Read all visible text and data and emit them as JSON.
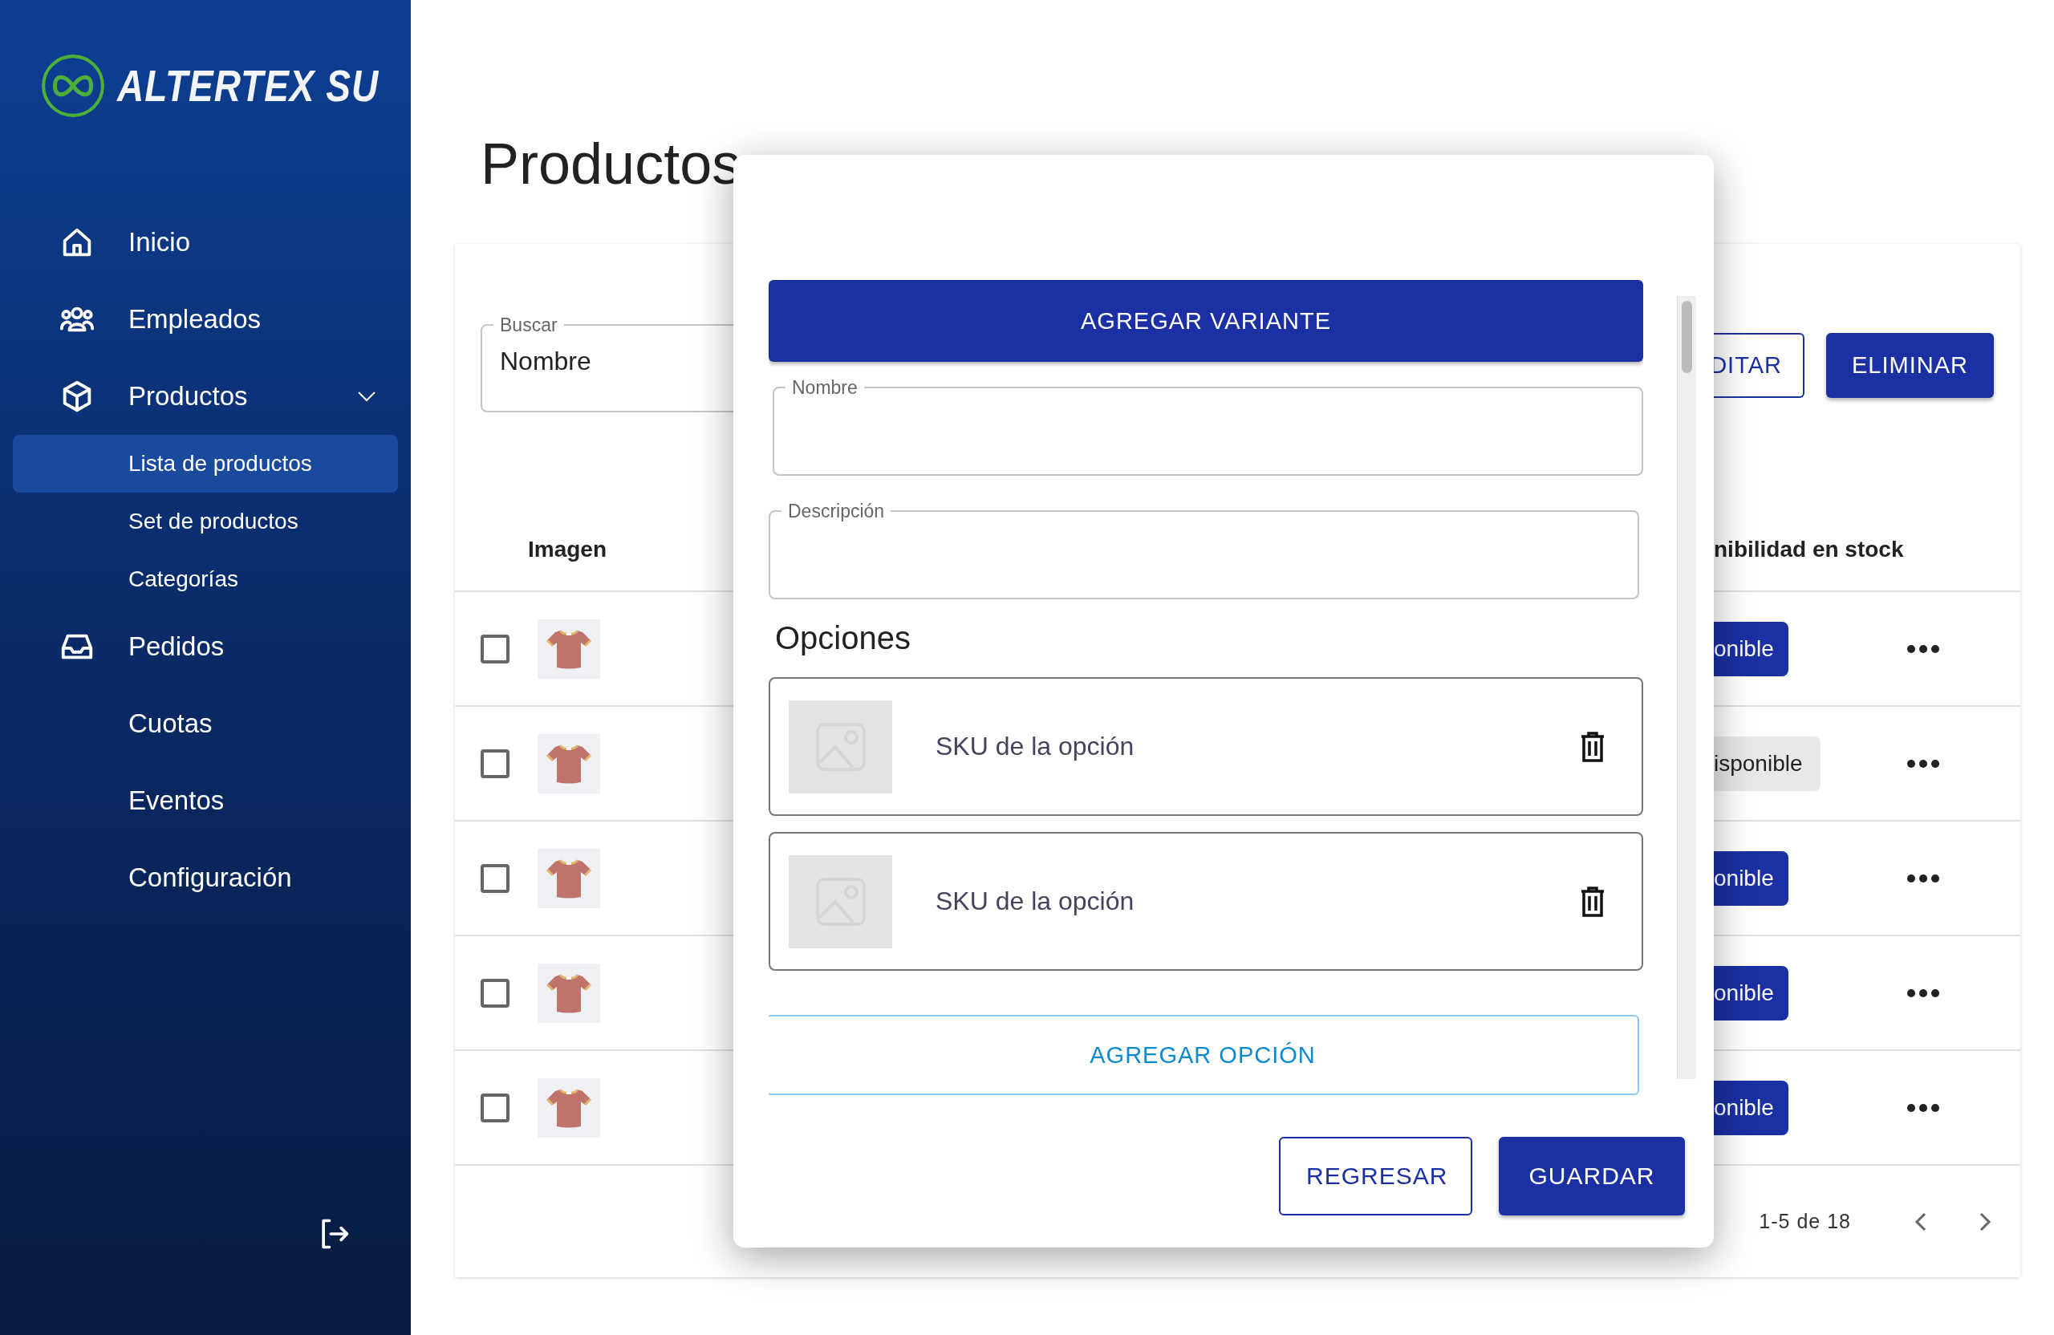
{
  "sidebar": {
    "logo": {
      "text": "ALTERTEX SU"
    },
    "items": [
      {
        "label": "Inicio",
        "selected": false
      },
      {
        "label": "Empleados",
        "selected": false
      },
      {
        "label": "Productos",
        "selected": false,
        "expanded": true,
        "children": [
          {
            "label": "Lista de productos",
            "selected": true
          },
          {
            "label": "Set de productos",
            "selected": false
          },
          {
            "label": "Categorías",
            "selected": false
          }
        ]
      },
      {
        "label": "Pedidos",
        "selected": false
      },
      {
        "label": "Cuotas",
        "selected": false
      },
      {
        "label": "Eventos",
        "selected": false
      },
      {
        "label": "Configuración",
        "selected": false
      }
    ]
  },
  "page": {
    "title": "Productos",
    "search": {
      "label": "Buscar",
      "value": "Nombre"
    },
    "buttons": [
      {
        "label": "DITAR",
        "kind": "outlined"
      },
      {
        "label": "ELIMINAR",
        "kind": "contained"
      }
    ],
    "table": {
      "columns": [
        {
          "label": "Imagen"
        },
        {
          "label": "nibilidad en stock"
        }
      ],
      "rows": [
        {
          "checked": false,
          "status": "onible",
          "available": true
        },
        {
          "checked": false,
          "status": "isponible",
          "available": false
        },
        {
          "checked": false,
          "status": "onible",
          "available": true
        },
        {
          "checked": false,
          "status": "onible",
          "available": true
        },
        {
          "checked": false,
          "status": "onible",
          "available": true
        }
      ]
    },
    "pagination": {
      "range": "1-5 de 18"
    }
  },
  "modal": {
    "add_variant_button": "AGREGAR VARIANTE",
    "fields": [
      {
        "label": "Nombre"
      },
      {
        "label": "Descripción"
      }
    ],
    "options_title": "Opciones",
    "options": [
      {
        "placeholder": "SKU de la opción"
      },
      {
        "placeholder": "SKU de la opción"
      }
    ],
    "add_option_button": "AGREGAR OPCIÓN",
    "buttons": [
      {
        "label": "REGRESAR",
        "kind": "outlined"
      },
      {
        "label": "GUARDAR",
        "kind": "contained"
      }
    ]
  }
}
